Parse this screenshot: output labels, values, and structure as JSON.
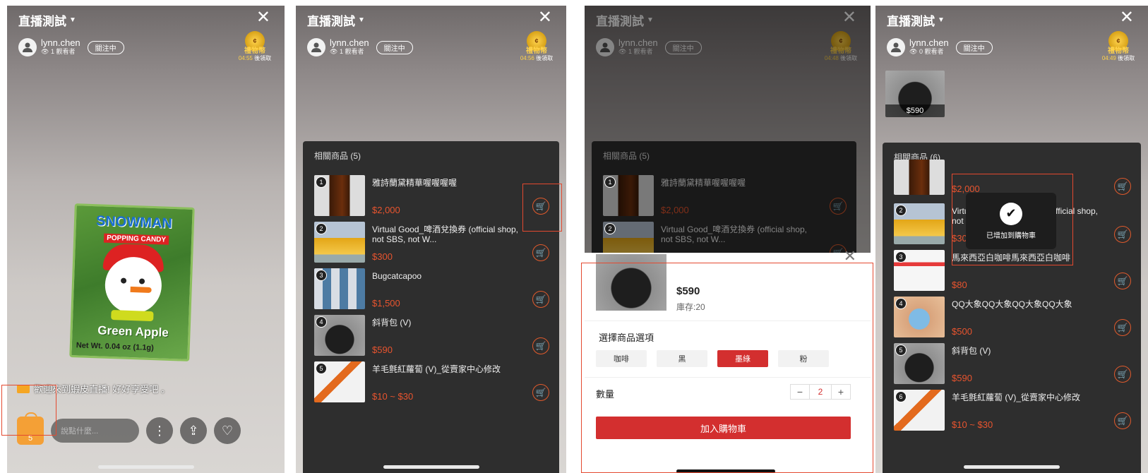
{
  "stream": {
    "title": "直播測試",
    "host": "lynn.chen",
    "follow": "關注中",
    "coin_label": "禮物幣",
    "coin_timer_suffix": "後領取"
  },
  "screens": [
    {
      "viewers": "1 觀看者",
      "timer": "04:55"
    },
    {
      "viewers": "1 觀看者",
      "timer": "04:56"
    },
    {
      "viewers": "1 觀看者",
      "timer": "04:48"
    },
    {
      "viewers": "0 觀看者",
      "timer": "04:49"
    }
  ],
  "candy": {
    "top": "SNOWMAN",
    "sub": "POPPING CANDY",
    "flavor": "Green Apple",
    "weight": "Net Wt. 0.04 oz (1.1g)"
  },
  "welcome": "歡迎來到蝦皮直播! 好好享受吧 。",
  "chat_placeholder": "說點什麼...",
  "cart_count": "5",
  "panel2": {
    "header": "相關商品 (5)",
    "items": [
      {
        "num": "1",
        "name": "雅詩蘭黛精華喔喔喔喔",
        "price": "$2,000"
      },
      {
        "num": "2",
        "name": "Virtual Good_啤酒兌換券 (official shop, not SBS, not W...",
        "price": "$300"
      },
      {
        "num": "3",
        "name": "Bugcatcapoo",
        "price": "$1,500"
      },
      {
        "num": "4",
        "name": "斜背包 (V)",
        "price": "$590"
      },
      {
        "num": "5",
        "name": "羊毛氈紅蘿蔔 (V)_從賣家中心修改",
        "price": "$10 ~ $30"
      }
    ]
  },
  "panel3": {
    "header": "相關商品 (5)",
    "items": [
      {
        "num": "1",
        "name": "雅詩蘭黛精華喔喔喔喔",
        "price": "$2,000"
      },
      {
        "num": "2",
        "name": "Virtual Good_啤酒兌換券 (official shop, not SBS, not W...",
        "price": ""
      }
    ],
    "sheet": {
      "price": "$590",
      "stock": "庫存:20",
      "options_label": "選擇商品選項",
      "options": [
        "咖啡",
        "黑",
        "墨綠",
        "粉"
      ],
      "selected": "墨綠",
      "qty_label": "數量",
      "qty": "2",
      "minus": "−",
      "plus": "+",
      "add_button": "加入購物車"
    }
  },
  "panel4": {
    "header": "相關商品 (6)",
    "float_price": "$590",
    "toast": "已增加到購物車",
    "items": [
      {
        "num": "1",
        "name": "雅詩蘭黛精華喔喔喔喔",
        "price": "$2,000"
      },
      {
        "num": "2",
        "name": "Virtual Good_啤酒兌換券 (official shop, not SBS, not W...",
        "price": "$300"
      },
      {
        "num": "3",
        "name": "馬來西亞白咖啡馬來西亞白咖啡",
        "price": "$80"
      },
      {
        "num": "4",
        "name": "QQ大象QQ大象QQ大象QQ大象",
        "price": "$500"
      },
      {
        "num": "5",
        "name": "斜背包 (V)",
        "price": "$590"
      },
      {
        "num": "6",
        "name": "羊毛氈紅蘿蔔 (V)_從賣家中心修改",
        "price": "$10 ~ $30"
      }
    ]
  },
  "icons": {
    "close": "close-icon",
    "cart": "cart-icon",
    "more": "more-icon",
    "share": "share-icon",
    "heart": "heart-icon"
  },
  "colors": {
    "accent": "#e05a2c",
    "highlight_box": "#e4492f",
    "button_red": "#d32f2f",
    "coin_gold": "#ffd24a"
  }
}
